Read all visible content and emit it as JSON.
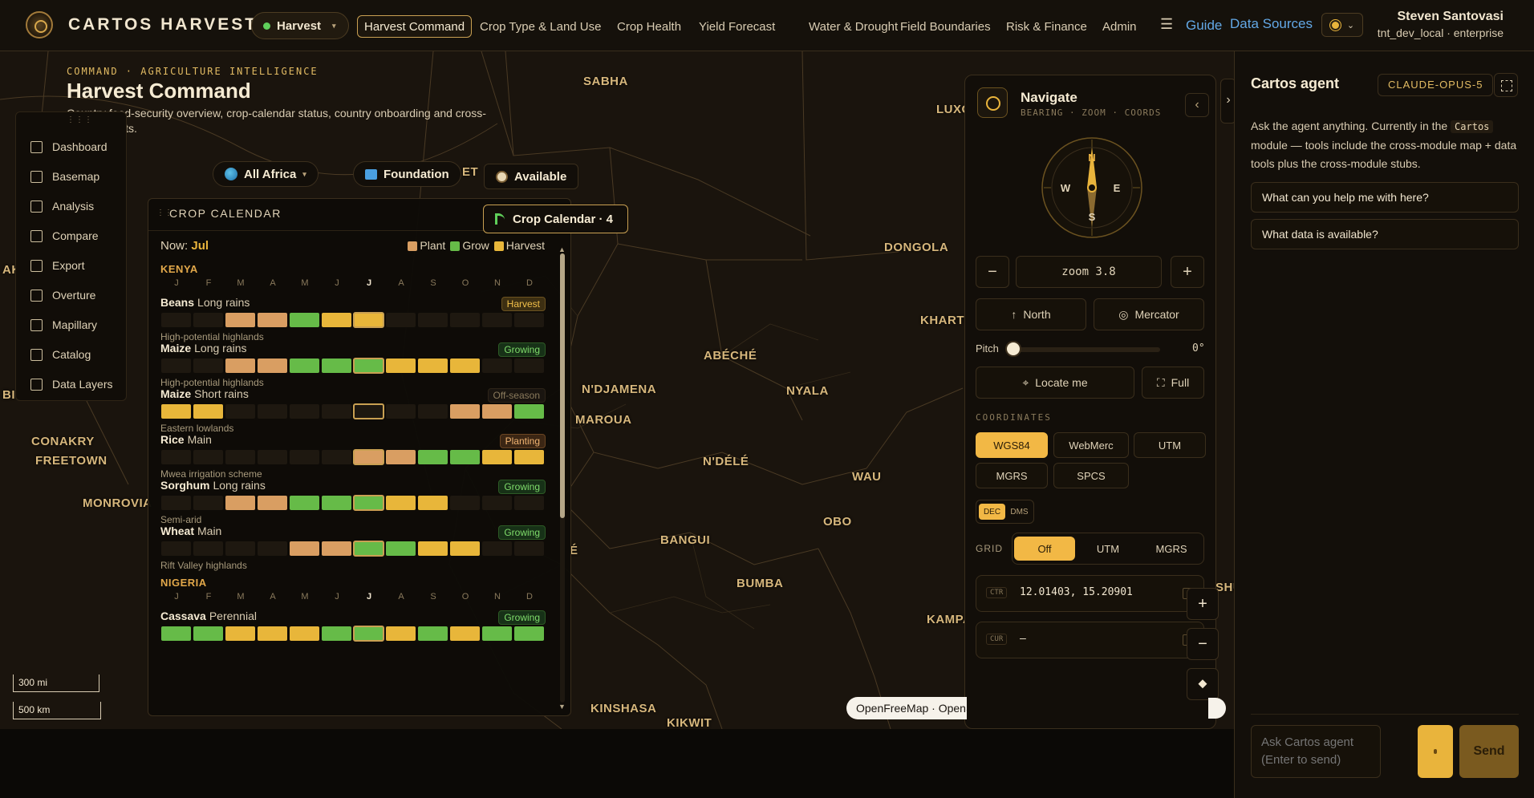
{
  "app": {
    "brand": "CARTOS HARVEST",
    "module": "Harvest",
    "nav_tabs": [
      "Harvest Command",
      "Crop Type & Land Use",
      "Crop Health",
      "Yield Forecast",
      "Water & Drought",
      "Field Boundaries",
      "Risk & Finance",
      "Admin"
    ],
    "active_tab": "Harvest Command",
    "guide": "Guide",
    "data_sources": "Data Sources",
    "user_name": "Steven Santovasi",
    "user_org": "tnt_dev_local · enterprise"
  },
  "page": {
    "kicker": "COMMAND · AGRICULTURE INTELLIGENCE",
    "title": "Harvest Command",
    "subtitle": "Country food-security overview, crop-calendar status, country onboarding and cross-module alerts."
  },
  "tool_menu": [
    "Dashboard",
    "Basemap",
    "Analysis",
    "Compare",
    "Export",
    "Overture",
    "Mapillary",
    "Catalog",
    "Data Layers"
  ],
  "filters": {
    "region": "All Africa",
    "tier": "Foundation",
    "availability": "Available",
    "layer_toggle": "Crop Calendar · 4"
  },
  "scale": {
    "miles": "300 mi",
    "km": "500 km"
  },
  "map_labels": [
    {
      "name": "SABHA"
    },
    {
      "name": "LUXO"
    },
    {
      "name": "DONGOLA"
    },
    {
      "name": "KHARTO"
    },
    {
      "name": "ABÉCHÉ"
    },
    {
      "name": "N'DJAMENA"
    },
    {
      "name": "NYALA"
    },
    {
      "name": "MAROUA"
    },
    {
      "name": "N'DÉLÉ"
    },
    {
      "name": "WAU"
    },
    {
      "name": "OBO"
    },
    {
      "name": "BANGUI"
    },
    {
      "name": "BUMBA"
    },
    {
      "name": "KAMPA"
    },
    {
      "name": "KINSHASA"
    },
    {
      "name": "KIKWIT"
    },
    {
      "name": "CONAKRY"
    },
    {
      "name": "FREETOWN"
    },
    {
      "name": "MONROVIA"
    },
    {
      "name": "BI"
    },
    {
      "name": "AK"
    },
    {
      "name": "SHU"
    },
    {
      "name": "ET"
    },
    {
      "name": "É"
    }
  ],
  "crop_calendar": {
    "title": "CROP CALENDAR",
    "now_label": "Now:",
    "now_month": "Jul",
    "current_month_index": 6,
    "legend": {
      "plant": "Plant",
      "grow": "Grow",
      "harvest": "Harvest"
    },
    "month_letters": [
      "J",
      "F",
      "M",
      "A",
      "M",
      "J",
      "J",
      "A",
      "S",
      "O",
      "N",
      "D"
    ],
    "countries": [
      {
        "name": "KENYA",
        "crops": [
          {
            "crop": "Beans",
            "season": "Long rains",
            "status": "Harvest",
            "status_kind": "harvest",
            "location": "High-potential highlands",
            "months": [
              "",
              "",
              "p",
              "p",
              "g",
              "h",
              "h",
              "",
              "",
              "",
              "",
              ""
            ]
          },
          {
            "crop": "Maize",
            "season": "Long rains",
            "status": "Growing",
            "status_kind": "grow",
            "location": "High-potential highlands",
            "months": [
              "",
              "",
              "p",
              "p",
              "g",
              "g",
              "g",
              "h",
              "h",
              "h",
              "",
              ""
            ]
          },
          {
            "crop": "Maize",
            "season": "Short rains",
            "status": "Off-season",
            "status_kind": "off",
            "location": "Eastern lowlands",
            "months": [
              "h",
              "h",
              "",
              "",
              "",
              "",
              "",
              "",
              "",
              "p",
              "p",
              "g"
            ]
          },
          {
            "crop": "Rice",
            "season": "Main",
            "status": "Planting",
            "status_kind": "plant",
            "location": "Mwea irrigation scheme",
            "months": [
              "",
              "",
              "",
              "",
              "",
              "",
              "p",
              "p",
              "g",
              "g",
              "h",
              "h"
            ]
          },
          {
            "crop": "Sorghum",
            "season": "Long rains",
            "status": "Growing",
            "status_kind": "grow",
            "location": "Semi-arid",
            "months": [
              "",
              "",
              "p",
              "p",
              "g",
              "g",
              "g",
              "h",
              "h",
              "",
              "",
              ""
            ]
          },
          {
            "crop": "Wheat",
            "season": "Main",
            "status": "Growing",
            "status_kind": "grow",
            "location": "Rift Valley highlands",
            "months": [
              "",
              "",
              "",
              "",
              "p",
              "p",
              "g",
              "g",
              "h",
              "h",
              "",
              ""
            ]
          }
        ]
      },
      {
        "name": "NIGERIA",
        "crops": [
          {
            "crop": "Cassava",
            "season": "Perennial",
            "status": "Growing",
            "status_kind": "grow",
            "location": "",
            "months": [
              "g",
              "g",
              "h",
              "h",
              "h",
              "g",
              "g",
              "h",
              "g",
              "h",
              "g",
              "g"
            ]
          }
        ]
      }
    ]
  },
  "navigate": {
    "title": "Navigate",
    "subtitle": "BEARING · ZOOM · COORDS",
    "compass": {
      "n": "N",
      "e": "E",
      "s": "S",
      "w": "W"
    },
    "zoom_label": "zoom 3.8",
    "zoom_minus": "−",
    "zoom_plus": "+",
    "north": "North",
    "projection": "Mercator",
    "pitch_label": "Pitch",
    "pitch_value": "0°",
    "pitch_fraction": 0,
    "locate": "Locate me",
    "full": "Full",
    "coords_title": "COORDINATES",
    "systems": [
      "WGS84",
      "WebMerc",
      "UTM",
      "MGRS",
      "SPCS"
    ],
    "active_system": "WGS84",
    "formats": [
      "DEC",
      "DMS"
    ],
    "active_format": "DEC",
    "grid_label": "GRID",
    "grid_options": [
      "Off",
      "UTM",
      "MGRS"
    ],
    "active_grid": "Off",
    "ctr_tag": "CTR",
    "ctr_value": "12.01403, 15.20901",
    "cur_tag": "CUR",
    "cur_value": "–"
  },
  "map_controls": {
    "plus": "+",
    "minus": "−"
  },
  "attribution": "OpenFreeMap · OpenStreetMap",
  "agent": {
    "title": "Cartos agent",
    "model": "CLAUDE-OPUS-5",
    "intro_before": "Ask the agent anything. Currently in the",
    "intro_module": "Cartos",
    "intro_after": "module — tools include the cross-module map + data tools plus the cross-module stubs.",
    "suggestions": [
      "What can you help me with here?",
      "What data is available?"
    ],
    "input_placeholder": "Ask Cartos agent (Enter to send)",
    "send": "Send"
  },
  "colors": {
    "accent": "#f2b845",
    "plant": "#d99e62",
    "grow": "#66bb48",
    "harvest": "#e8b63a",
    "link": "#63a8e6"
  }
}
